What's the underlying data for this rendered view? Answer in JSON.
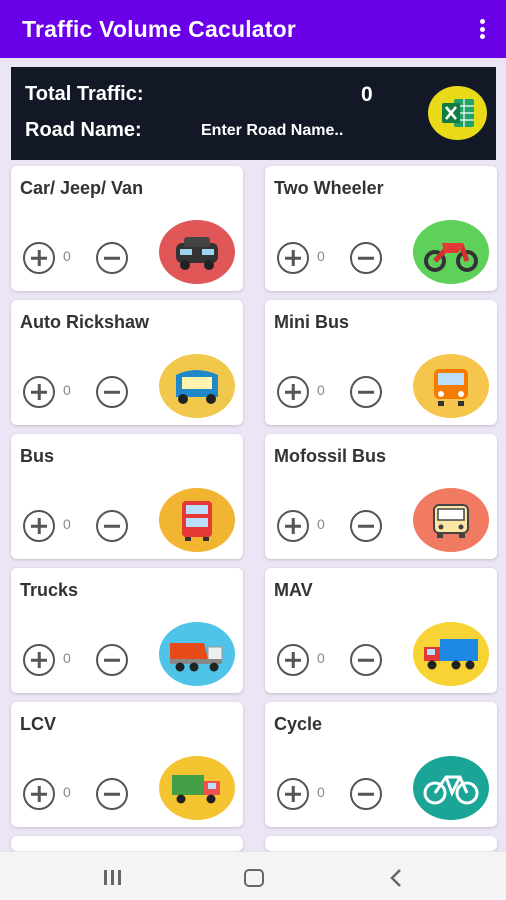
{
  "app": {
    "title": "Traffic Volume Caculator"
  },
  "summary": {
    "total_label": "Total Traffic:",
    "total_value": "0",
    "road_label": "Road Name:",
    "road_placeholder": "Enter Road Name..",
    "road_value": ""
  },
  "vehicles": [
    {
      "name": "Car/ Jeep/ Van",
      "count": "0",
      "icon": "car-icon",
      "color": "#e15656"
    },
    {
      "name": "Two Wheeler",
      "count": "0",
      "icon": "motorcycle-icon",
      "color": "#5ed15a"
    },
    {
      "name": "Auto Rickshaw",
      "count": "0",
      "icon": "auto-rickshaw-icon",
      "color": "#f2c84c"
    },
    {
      "name": "Mini Bus",
      "count": "0",
      "icon": "mini-bus-icon",
      "color": "#f5c64b"
    },
    {
      "name": "Bus",
      "count": "0",
      "icon": "double-decker-bus-icon",
      "color": "#f2b531"
    },
    {
      "name": "Mofossil Bus",
      "count": "0",
      "icon": "bus-front-icon",
      "color": "#f07a62"
    },
    {
      "name": "Trucks",
      "count": "0",
      "icon": "dump-truck-icon",
      "color": "#4fc3e8"
    },
    {
      "name": "MAV",
      "count": "0",
      "icon": "container-truck-icon",
      "color": "#f7d433"
    },
    {
      "name": "LCV",
      "count": "0",
      "icon": "light-truck-icon",
      "color": "#f5c531"
    },
    {
      "name": "Cycle",
      "count": "0",
      "icon": "bicycle-icon",
      "color": "#1aa596"
    }
  ],
  "colors": {
    "app_bar": "#6a00e8",
    "summary_bg": "#121826",
    "page_bg": "#ece5f6",
    "excel": "#e8d919"
  },
  "excel_icon": "excel-icon"
}
